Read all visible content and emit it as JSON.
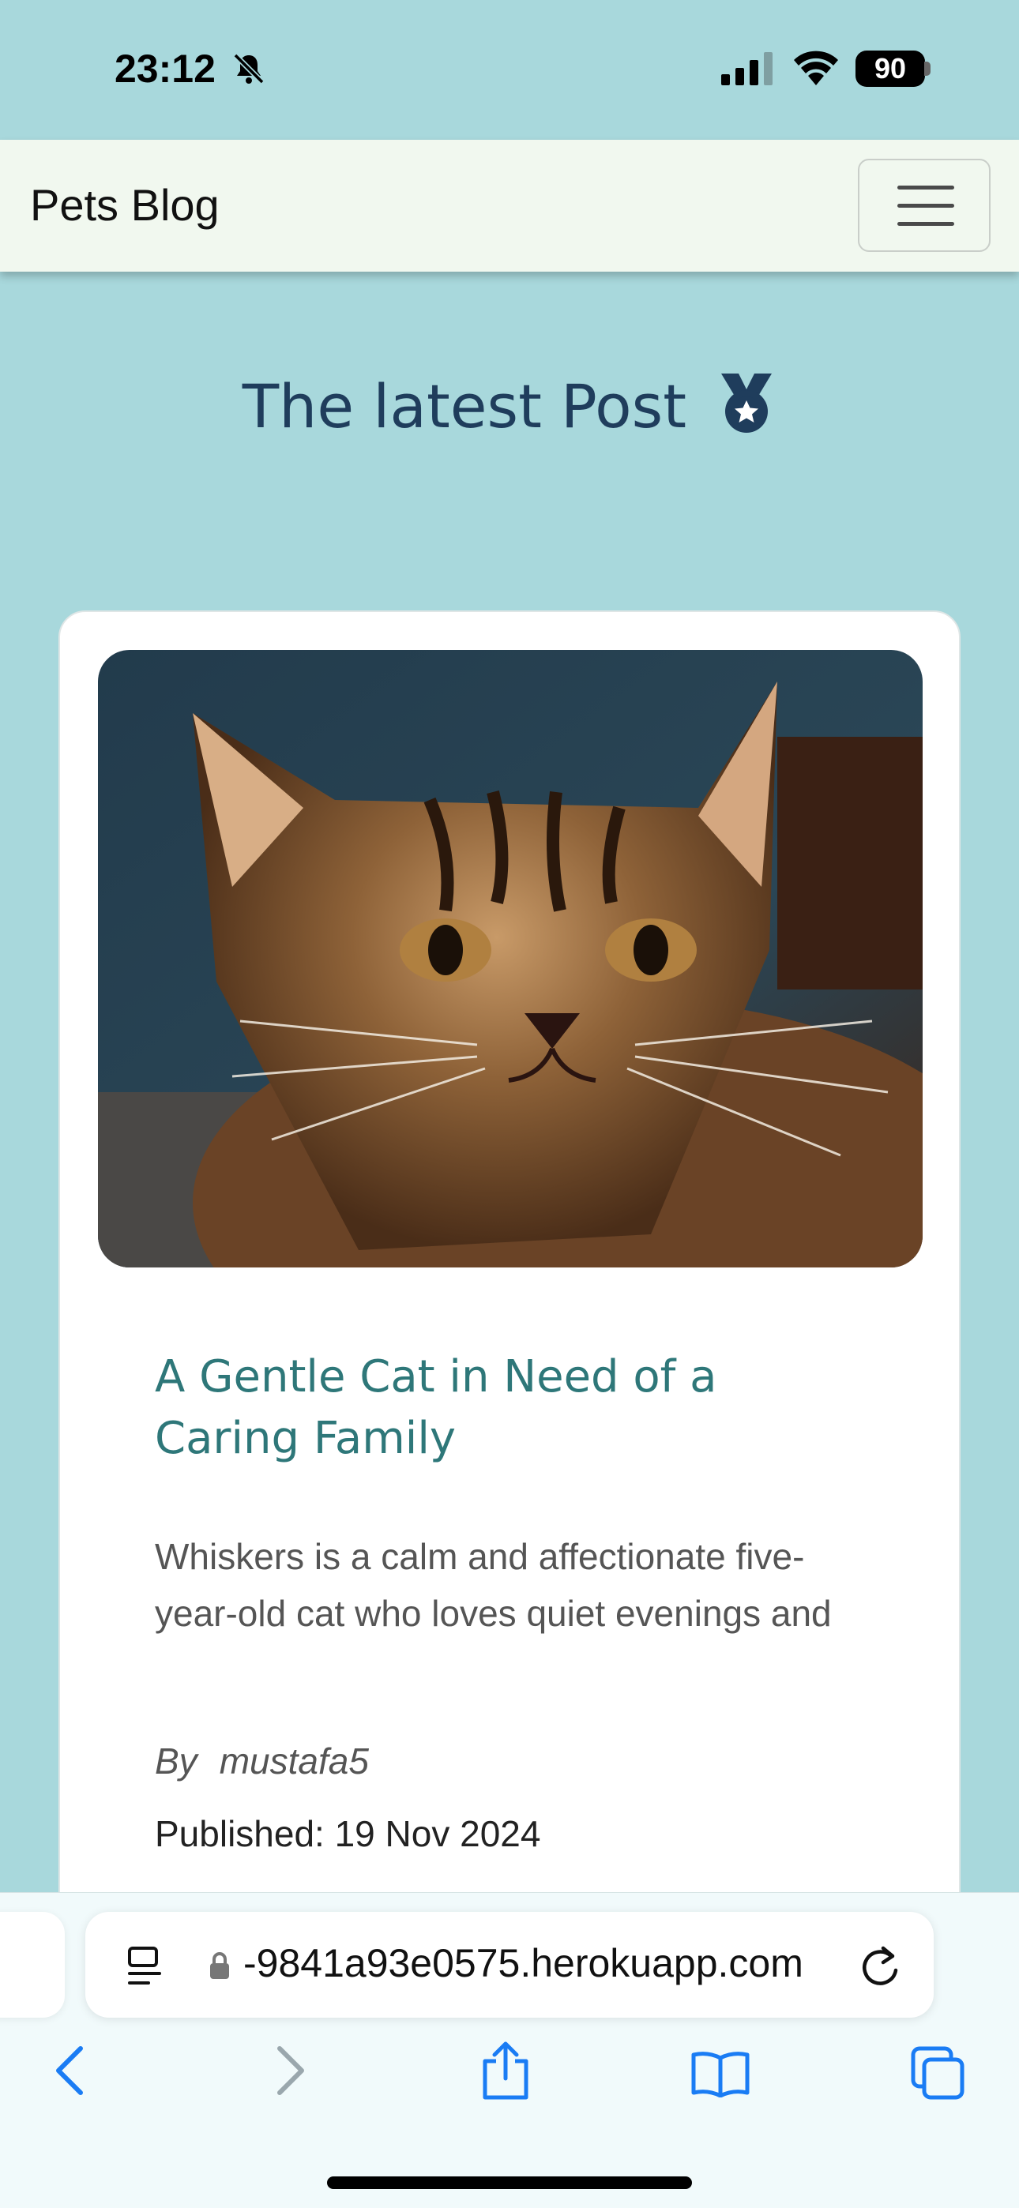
{
  "status_bar": {
    "time": "23:12",
    "battery": "90",
    "icons": [
      "bell-slash-icon",
      "signal-icon",
      "wifi-icon",
      "battery-icon"
    ]
  },
  "navbar": {
    "brand": "Pets Blog",
    "menu_icon": "hamburger-icon"
  },
  "heading": {
    "text": "The latest Post",
    "icon": "medal-icon"
  },
  "post": {
    "image_icon": "cat-photo",
    "title": "A Gentle Cat in Need of a Caring Family",
    "excerpt": "Whiskers is a calm and affectionate five-year-old cat who loves quiet evenings and",
    "author_prefix": "By",
    "author": "mustafa5",
    "published": "Published: 19 Nov 2024"
  },
  "browser": {
    "url": "-9841a93e0575.herokuapp.com",
    "icons": [
      "reader-icon",
      "lock-icon",
      "reload-icon",
      "back-icon",
      "forward-icon",
      "share-icon",
      "bookmarks-icon",
      "tabs-icon"
    ]
  },
  "colors": {
    "page_bg": "#a8d8dc",
    "navbar_bg": "#f1f8ef",
    "heading": "#1f3d5c",
    "title": "#2e7779",
    "ios_blue": "#1a7cf4"
  }
}
